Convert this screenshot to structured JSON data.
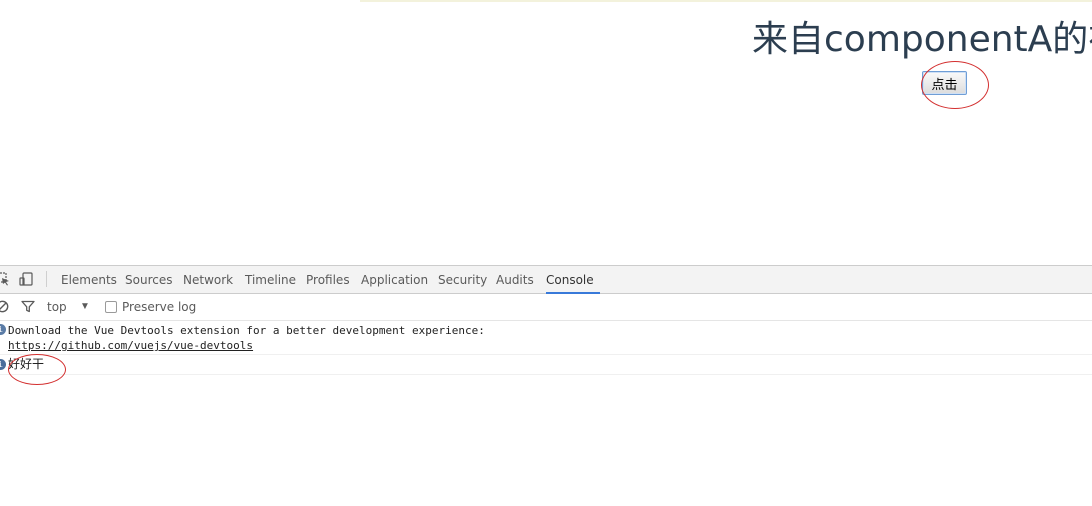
{
  "page": {
    "heading": "来自componentA的祝福",
    "button_label": "点击"
  },
  "devtools": {
    "tabs": [
      {
        "label": "Elements",
        "active": false
      },
      {
        "label": "Sources",
        "active": false
      },
      {
        "label": "Network",
        "active": false
      },
      {
        "label": "Timeline",
        "active": false
      },
      {
        "label": "Profiles",
        "active": false
      },
      {
        "label": "Application",
        "active": false
      },
      {
        "label": "Security",
        "active": false
      },
      {
        "label": "Audits",
        "active": false
      },
      {
        "label": "Console",
        "active": true
      }
    ],
    "toolbar": {
      "context": "top",
      "preserve_log_label": "Preserve log",
      "preserve_log_checked": false
    },
    "console": {
      "messages": [
        {
          "text": "Download the Vue Devtools extension for a better development experience:",
          "link": "https://github.com/vuejs/vue-devtools"
        },
        {
          "text": "好好干"
        }
      ]
    }
  },
  "colors": {
    "heading": "#2c3e50",
    "annotation": "#d32f2f",
    "active_tab_underline": "#3879d9"
  },
  "icons": {
    "inspect": "inspect-element-icon",
    "device": "device-toolbar-icon",
    "clear": "clear-console-icon",
    "filter": "filter-icon",
    "dropdown": "dropdown-arrow-icon",
    "info": "info-icon"
  }
}
